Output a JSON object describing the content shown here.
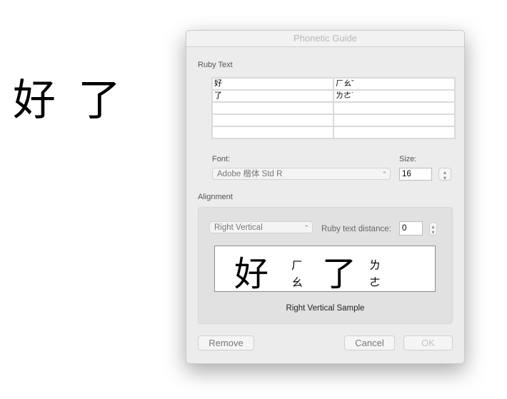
{
  "document": {
    "text": "好 了"
  },
  "dialog": {
    "title": "Phonetic Guide",
    "ruby_text_label": "Ruby Text",
    "rows": [
      {
        "base": "好",
        "ruby": "ㄏㄠˇ"
      },
      {
        "base": "了",
        "ruby": "ㄌㄜ˙"
      },
      {
        "base": "",
        "ruby": ""
      },
      {
        "base": "",
        "ruby": ""
      },
      {
        "base": "",
        "ruby": ""
      }
    ],
    "font_label": "Font:",
    "font_value": "Adobe 楷体 Std R",
    "size_label": "Size:",
    "size_value": "16",
    "alignment_label": "Alignment",
    "alignment_value": "Right Vertical",
    "distance_label": "Ruby text distance:",
    "distance_value": "0",
    "preview": {
      "base1": "好",
      "ruby1a": "ㄏ",
      "ruby1b": "ㄠ",
      "base2": "了",
      "ruby2a": "ㄌ",
      "ruby2b": "ㄜ"
    },
    "sample_caption": "Right Vertical Sample",
    "remove_label": "Remove",
    "cancel_label": "Cancel",
    "ok_label": "OK"
  }
}
